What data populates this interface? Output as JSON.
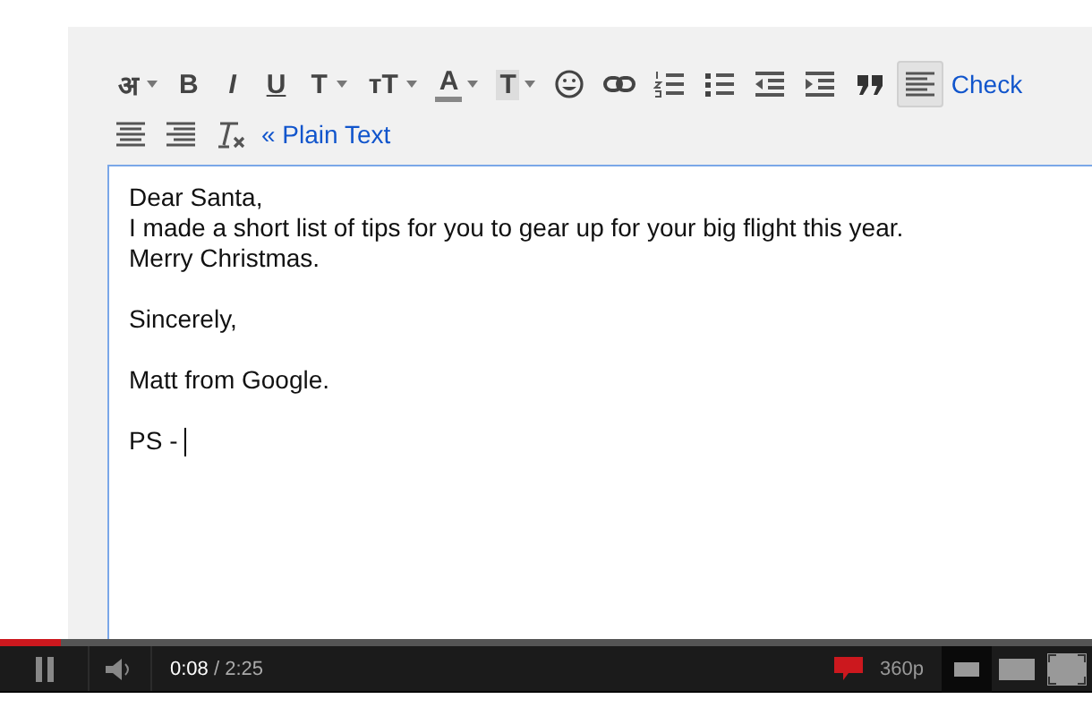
{
  "toolbar": {
    "rows": [
      [
        {
          "kind": "glyph",
          "label": "अ",
          "dropdown": true,
          "selected": false
        },
        {
          "kind": "bold",
          "label": "B",
          "selected": false
        },
        {
          "kind": "italic",
          "label": "I",
          "selected": false
        },
        {
          "kind": "underline",
          "label": "U",
          "selected": false
        },
        {
          "kind": "glyph",
          "label": "T",
          "dropdown": true,
          "selected": false
        },
        {
          "kind": "glyph",
          "label": "тT",
          "dropdown": true,
          "selected": false
        },
        {
          "kind": "color",
          "label": "A",
          "dropdown": true,
          "selected": false
        },
        {
          "kind": "highlight",
          "label": "T",
          "dropdown": true,
          "selected": false
        },
        {
          "kind": "emoji",
          "selected": false
        },
        {
          "kind": "link",
          "selected": false
        },
        {
          "kind": "numbered",
          "selected": false
        },
        {
          "kind": "bulleted",
          "selected": false
        },
        {
          "kind": "outdent",
          "selected": false
        },
        {
          "kind": "indent",
          "selected": false
        },
        {
          "kind": "quote",
          "selected": false
        },
        {
          "kind": "align-left",
          "selected": true
        },
        {
          "kind": "link-text",
          "label": "Check",
          "selected": false
        }
      ],
      [
        {
          "kind": "align-center",
          "selected": false
        },
        {
          "kind": "align-right",
          "selected": false
        },
        {
          "kind": "clear",
          "selected": false
        },
        {
          "kind": "link-text",
          "label": "« Plain Text",
          "selected": false
        }
      ]
    ]
  },
  "body": {
    "paragraphs": [
      [
        "Dear Santa,",
        "I made a short list of tips for you to gear up for your big flight this year.",
        "Merry Christmas."
      ],
      [
        "Sincerely,"
      ],
      [
        "Matt from Google."
      ],
      [
        "PS -"
      ]
    ]
  },
  "player": {
    "progress": {
      "level": 0.055
    },
    "playing": true,
    "time": "**0:08** / 2:25",
    "quality": "360p",
    "sizes": [
      {
        "kind": "small",
        "selected": true
      },
      {
        "kind": "large",
        "selected": false
      },
      {
        "kind": "fullscreen",
        "selected": false
      }
    ]
  }
}
